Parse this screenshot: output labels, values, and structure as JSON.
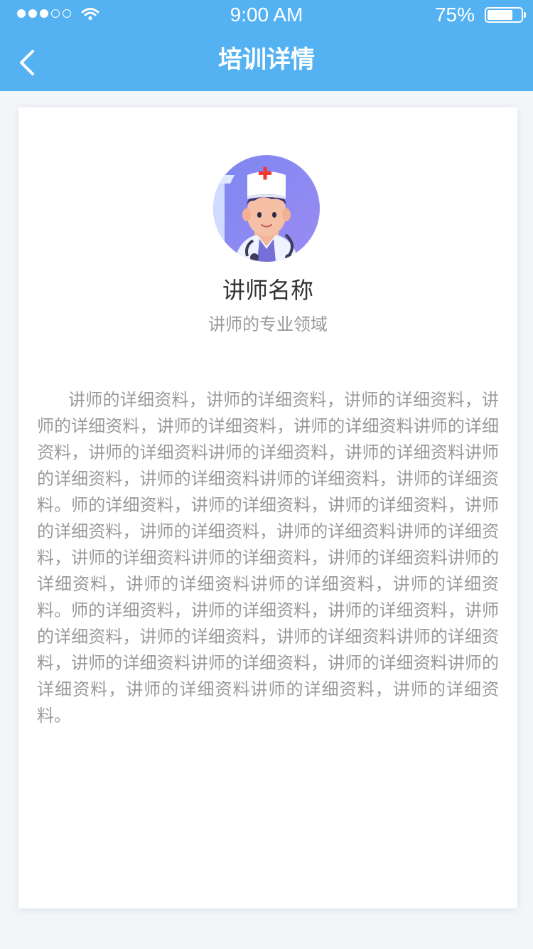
{
  "status_bar": {
    "time": "9:00 AM",
    "battery_text": "75%",
    "battery_level": 0.75
  },
  "nav": {
    "title": "培训详情"
  },
  "lecturer": {
    "name": "讲师名称",
    "field": "讲师的专业领域",
    "bio": "讲师的详细资料，讲师的详细资料，讲师的详细资料，讲师的详细资料，讲师的详细资料，讲师的详细资料讲师的详细资料，讲师的详细资料讲师的详细资料，讲师的详细资料讲师的详细资料，讲师的详细资料讲师的详细资料，讲师的详细资料。师的详细资料，讲师的详细资料，讲师的详细资料，讲师的详细资料，讲师的详细资料，讲师的详细资料讲师的详细资料，讲师的详细资料讲师的详细资料，讲师的详细资料讲师的详细资料，讲师的详细资料讲师的详细资料，讲师的详细资料。师的详细资料，讲师的详细资料，讲师的详细资料，讲师的详细资料，讲师的详细资料，讲师的详细资料讲师的详细资料，讲师的详细资料讲师的详细资料，讲师的详细资料讲师的详细资料，讲师的详细资料讲师的详细资料，讲师的详细资料。"
  },
  "icons": {
    "back": "chevron-left-icon",
    "wifi": "wifi-icon",
    "battery": "battery-icon",
    "avatar": "doctor-avatar"
  },
  "colors": {
    "header": "#55b2f2",
    "background": "#f4f5f7",
    "card": "#ffffff",
    "name_text": "#333333",
    "secondary_text": "#999999",
    "avatar_bg": "#8a8ff2"
  }
}
